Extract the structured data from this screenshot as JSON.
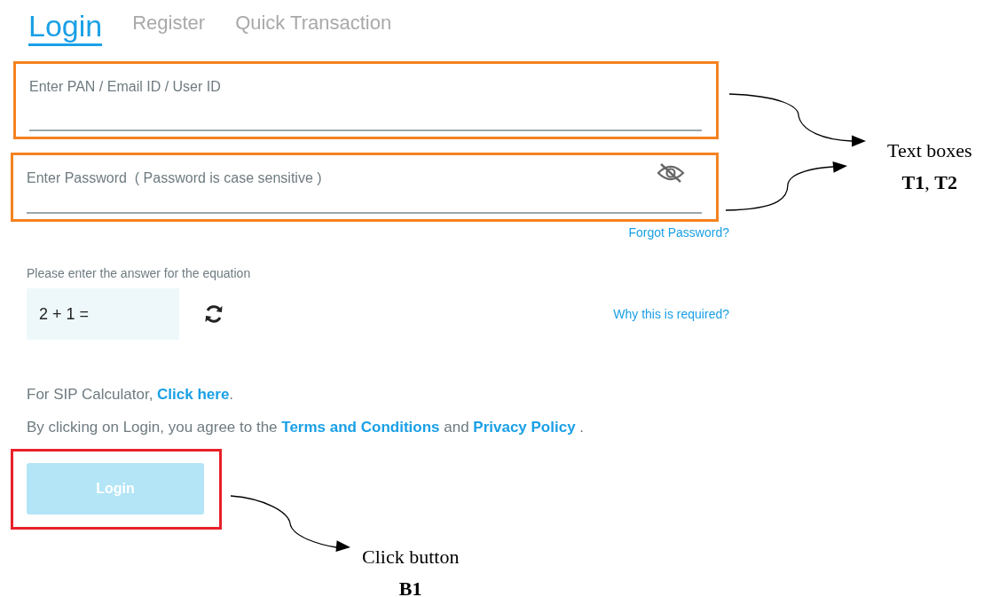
{
  "tabs": [
    {
      "label": "Login",
      "selected": true
    },
    {
      "label": "Register",
      "selected": false
    },
    {
      "label": "Quick Transaction",
      "selected": false
    }
  ],
  "fields": [
    {
      "kind": "text",
      "placeholder": "Enter PAN / Email ID / User ID"
    },
    {
      "kind": "password",
      "placeholder": "Enter Password  ( Password is case sensitive )"
    }
  ],
  "forgot_link": "Forgot Password?",
  "captcha": {
    "prompt": "Please enter the answer for the equation",
    "equation": "2 + 1 =",
    "help_link": "Why this is required?"
  },
  "sip_note": {
    "text": "For SIP Calculator, ",
    "link": "Click here",
    "end": "."
  },
  "terms_note": {
    "text": "By clicking on Login, you agree to the ",
    "link_1": "Terms and Conditions",
    "middle": " and ",
    "link_2": "Privacy Policy",
    "end": " ."
  },
  "login_button": {
    "label": "Login",
    "disabled": true
  },
  "annotations": [
    {
      "kind": "fields",
      "label": "Text boxes",
      "ref": "**T1**, **T2**"
    },
    {
      "kind": "button",
      "label": "Click button",
      "ref": "B1"
    }
  ]
}
